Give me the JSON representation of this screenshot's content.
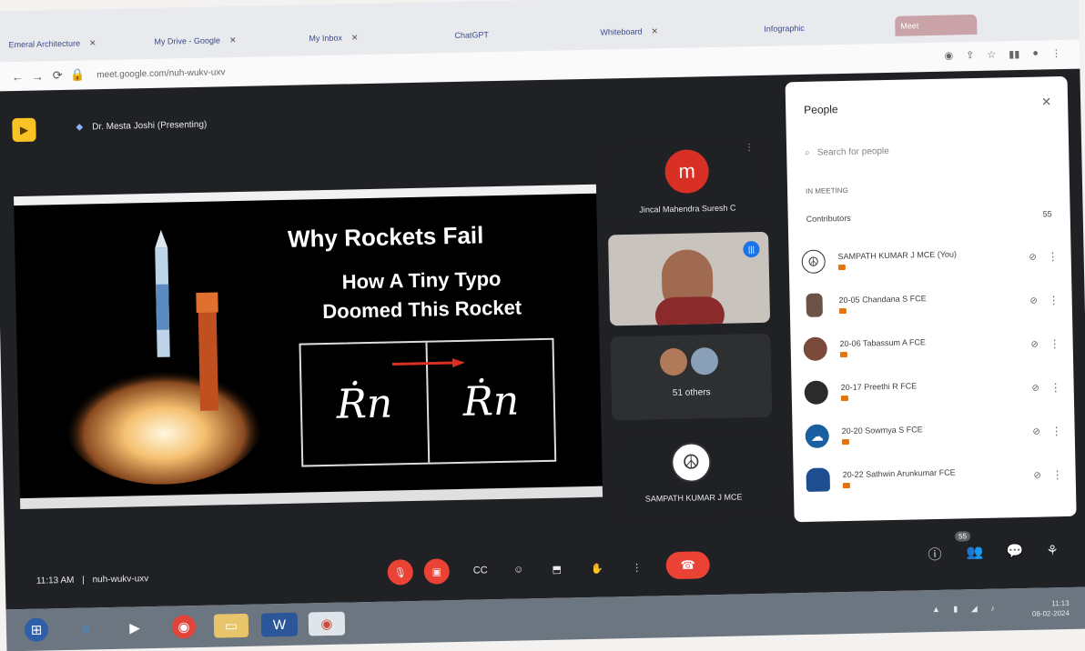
{
  "browser": {
    "tabs": [
      {
        "label": "Emeral Architecture"
      },
      {
        "label": "My Drive - Google"
      },
      {
        "label": "My Inbox"
      },
      {
        "label": "ChatGPT"
      },
      {
        "label": "Whiteboard"
      },
      {
        "label": "Infographic"
      },
      {
        "label": "Meet"
      }
    ],
    "url": "meet.google.com/nuh-wukv-uxv",
    "close_glyph": "✕"
  },
  "meet": {
    "presenter_label": "Dr. Mesta Joshi (Presenting)",
    "slide": {
      "title": "Why Rockets Fail",
      "subtitle_line1": "How A Tiny Typo",
      "subtitle_line2": "Doomed This Rocket",
      "eq_left": "Ṙn",
      "eq_right": "Ṙn"
    },
    "tiles": [
      {
        "avatar_letter": "m",
        "name": "Jincal Mahendra Suresh C",
        "avatar_color": "#d93025"
      },
      {
        "name": ""
      },
      {
        "others_label": "51 others"
      },
      {
        "name": "SAMPATH KUMAR J MCE"
      }
    ],
    "people_panel": {
      "title": "People",
      "search_placeholder": "Search for people",
      "section_label": "IN MEETING",
      "contributors_label": "Contributors",
      "contributors_count": "55",
      "people": [
        {
          "name": "SAMPATH KUMAR J MCE (You)"
        },
        {
          "name": "20-05 Chandana S FCE"
        },
        {
          "name": "20-06 Tabassum A FCE"
        },
        {
          "name": "20-17 Preethi R FCE"
        },
        {
          "name": "20-20 Sowmya S FCE"
        },
        {
          "name": "20-22 Sathwin Arunkumar FCE"
        }
      ]
    },
    "bottom": {
      "time": "11:13 AM",
      "meeting_code": "nuh-wukv-uxv",
      "participants_badge": "55"
    }
  },
  "taskbar": {
    "time": "11:13",
    "date": "08-02-2024"
  }
}
